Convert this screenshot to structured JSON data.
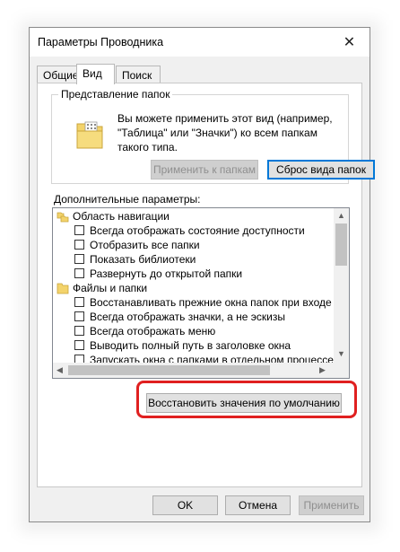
{
  "window": {
    "title": "Параметры Проводника",
    "close_glyph": "✕"
  },
  "tabs": [
    {
      "label": "Общие",
      "active": false
    },
    {
      "label": "Вид",
      "active": true
    },
    {
      "label": "Поиск",
      "active": false
    }
  ],
  "folder_view": {
    "group_label": "Представление папок",
    "description": "Вы можете применить этот вид (например, \"Таблица\" или \"Значки\") ко всем папкам такого типа.",
    "apply_button": "Применить к папкам",
    "reset_button": "Сброс вида папок"
  },
  "advanced": {
    "label": "Дополнительные параметры:",
    "items": [
      {
        "type": "category",
        "text": "Область навигации",
        "icon": "nav-pane-icon"
      },
      {
        "type": "checkbox",
        "text": "Всегда отображать состояние доступности",
        "checked": false
      },
      {
        "type": "checkbox",
        "text": "Отобразить все папки",
        "checked": false
      },
      {
        "type": "checkbox",
        "text": "Показать библиотеки",
        "checked": false
      },
      {
        "type": "checkbox",
        "text": "Развернуть до открытой папки",
        "checked": false
      },
      {
        "type": "category",
        "text": "Файлы и папки",
        "icon": "folder-icon"
      },
      {
        "type": "checkbox",
        "text": "Восстанавливать прежние окна папок при входе в систему",
        "checked": false
      },
      {
        "type": "checkbox",
        "text": "Всегда отображать значки, а не эскизы",
        "checked": false
      },
      {
        "type": "checkbox",
        "text": "Всегда отображать меню",
        "checked": false
      },
      {
        "type": "checkbox",
        "text": "Выводить полный путь в заголовке окна",
        "checked": false
      },
      {
        "type": "checkbox",
        "text": "Запускать окна с папками в отдельном процессе",
        "checked": false
      }
    ]
  },
  "restore_defaults_button": "Восстановить значения по умолчанию",
  "footer": {
    "ok": "OK",
    "cancel": "Отмена",
    "apply": "Применить"
  },
  "colors": {
    "highlight": "#e02020",
    "focus": "#0078d7",
    "folder": "#f3d36b"
  }
}
